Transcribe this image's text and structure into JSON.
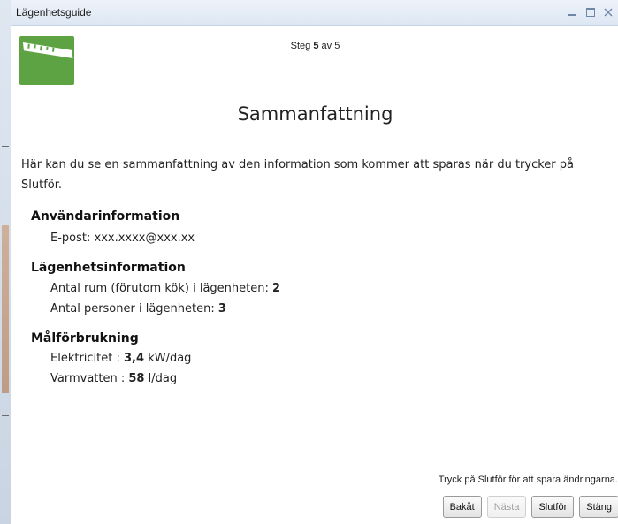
{
  "window": {
    "title": "Lägenhetsguide",
    "controls": [
      "minimize-icon",
      "maximize-icon",
      "close-icon"
    ]
  },
  "header": {
    "logo_icon": "ruler-icon",
    "step_prefix": "Steg",
    "step_current": "5",
    "step_middle": "av",
    "step_total": "5"
  },
  "main": {
    "heading": "Sammanfattning",
    "intro": "Här kan du se en sammanfattning av den information som kommer att sparas när du trycker på Slutför.",
    "sections": [
      {
        "title": "Användarinformation",
        "email_label": "E-post:",
        "email_value": "xxx.xxxx@xxx.xx"
      },
      {
        "title": "Lägenhetsinformation",
        "rooms_label": "Antal rum (förutom kök) i lägenheten:",
        "rooms_value": "2",
        "persons_label": "Antal personer i lägenheten:",
        "persons_value": "3"
      },
      {
        "title": "Målförbrukning",
        "electricity_label": "Elektricitet :",
        "electricity_value": "3,4",
        "electricity_unit": "kW/dag",
        "hotwater_label": "Varmvatten :",
        "hotwater_value": "58",
        "hotwater_unit": "l/dag"
      }
    ]
  },
  "footer": {
    "hint": "Tryck på Slutför för att spara ändringarna.",
    "back": "Bakåt",
    "next": "Nästa",
    "finish": "Slutför",
    "close": "Stäng"
  },
  "colors": {
    "logo_green": "#5ea343",
    "titlebar": "#dde7f3"
  }
}
